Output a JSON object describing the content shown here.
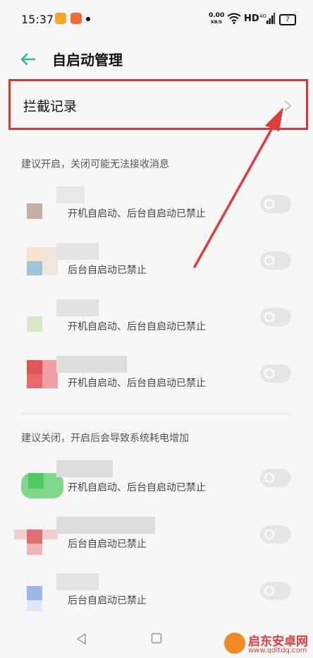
{
  "status_bar": {
    "time": "15:37",
    "speed_value": "0.00",
    "speed_unit": "KB/S",
    "network": "HD",
    "signal": "4G",
    "battery": "7"
  },
  "header": {
    "title": "自启动管理",
    "back_icon": "arrow-left-icon"
  },
  "intercept": {
    "label": "拦截记录",
    "icon": "chevron-right-icon",
    "highlight_color": "#d9383b"
  },
  "sections": [
    {
      "title": "建议开启，关闭可能无法接收消息",
      "apps": [
        {
          "status": "开机自启动、后台自启动已禁止",
          "enabled": false
        },
        {
          "status": "后台自启动已禁止",
          "enabled": false
        },
        {
          "status": "开机自启动、后台自启动已禁止",
          "enabled": false
        },
        {
          "status": "开机自启动、后台自启动已禁止",
          "enabled": false
        }
      ]
    },
    {
      "title": "建议关闭，开启后会导致系统耗电增加",
      "apps": [
        {
          "status": "开机自启动、后台自启动已禁止",
          "enabled": false
        },
        {
          "status": "后台自启动已禁止",
          "enabled": false
        },
        {
          "status": "后台自启动已禁止",
          "enabled": false
        }
      ]
    }
  ],
  "nav_bar": {
    "back": "triangle-back-icon",
    "home": "square-home-icon"
  },
  "watermark": {
    "name": "启东安卓网",
    "url": "www.qdltdq.com"
  },
  "colors": {
    "accent": "#27b99a",
    "annotation": "#e23b3b"
  }
}
